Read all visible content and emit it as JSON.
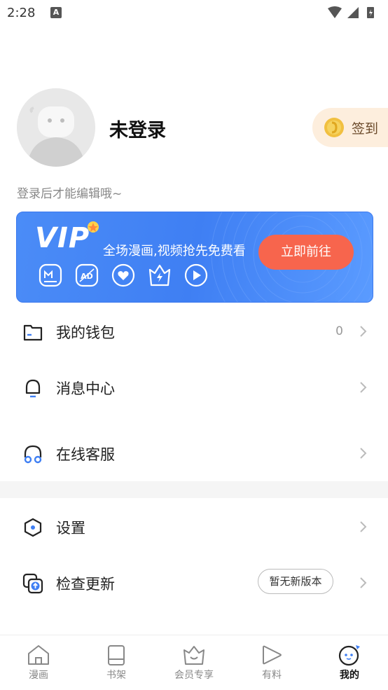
{
  "status_bar": {
    "time": "2:28",
    "notification_letter": "A"
  },
  "profile": {
    "username": "未登录",
    "hint": "登录后才能编辑哦~",
    "signin_label": "签到"
  },
  "vip": {
    "logo": "VIP",
    "slogan": "全场漫画,视频抢先免费看",
    "button": "立即前往"
  },
  "menu": {
    "wallet": {
      "label": "我的钱包",
      "value": "0"
    },
    "messages": {
      "label": "消息中心"
    },
    "support": {
      "label": "在线客服"
    },
    "settings": {
      "label": "设置"
    },
    "update": {
      "label": "检查更新",
      "status": "暂无新版本"
    }
  },
  "tabs": [
    {
      "label": "漫画",
      "icon": "home-icon"
    },
    {
      "label": "书架",
      "icon": "bookshelf-icon"
    },
    {
      "label": "会员专享",
      "icon": "crown-icon"
    },
    {
      "label": "有料",
      "icon": "play-icon"
    },
    {
      "label": "我的",
      "icon": "profile-face-icon",
      "active": true
    }
  ],
  "colors": {
    "accent": "#3f7ff3",
    "cta": "#f7654d",
    "signin_bg": "#fdeedd"
  }
}
